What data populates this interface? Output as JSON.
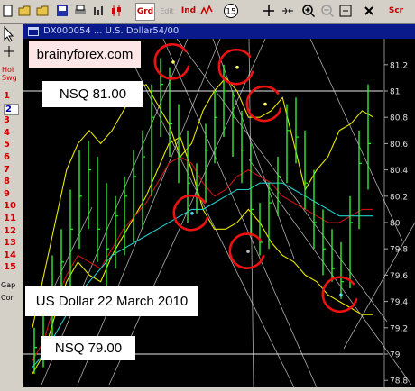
{
  "toolbar": {
    "fn_label": "Grd",
    "edit_label": "Edit",
    "ind_label": "Ind",
    "circle_label": "15",
    "scr_label": "Scr"
  },
  "left_panel": {
    "hot": "Hot",
    "swg": "Swg",
    "numbers": [
      "1",
      "2",
      "3",
      "4",
      "5",
      "6",
      "7",
      "8",
      "9",
      "10",
      "11",
      "12",
      "13",
      "14",
      "15"
    ],
    "gap": "Gap",
    "con": "Con"
  },
  "window": {
    "title": "DX000054 ... U.S. Dollar54/00"
  },
  "overlays": {
    "site": "brainyforex.com",
    "nsq_top": "NSQ 81.00",
    "caption": "US Dollar 22 March 2010",
    "nsq_bottom": "NSQ 79.00"
  },
  "colors": {
    "background": "#000000",
    "bars": "#33ee33",
    "yellow_band": "#e8e800",
    "red_ma": "#cc1111",
    "cyan_ma": "#22cccc",
    "white_lines": "#e8e8e8",
    "circles": "#ee1111",
    "title_bar": "#0a1a8a"
  },
  "chart_data": {
    "type": "bar",
    "title": "",
    "xlabel": "",
    "ylabel": "",
    "ylim": [
      78.8,
      81.3
    ],
    "y_ticks": [
      "81.2",
      "81",
      "80.8",
      "80.6",
      "80.4",
      "80.2",
      "80",
      "79.8",
      "79.6",
      "79.4",
      "79.2",
      "79",
      "78.8"
    ],
    "y_tick_values": [
      81.2,
      81.0,
      80.8,
      80.6,
      80.4,
      80.2,
      80.0,
      79.8,
      79.6,
      79.4,
      79.2,
      79.0,
      78.8
    ],
    "horizontal_levels": [
      81.0,
      79.0
    ],
    "bars": [
      {
        "h": 79.2,
        "l": 78.85,
        "c": 79.05
      },
      {
        "h": 79.45,
        "l": 78.9,
        "c": 79.3
      },
      {
        "h": 79.75,
        "l": 79.05,
        "c": 79.5
      },
      {
        "h": 79.95,
        "l": 79.3,
        "c": 79.7
      },
      {
        "h": 80.25,
        "l": 79.5,
        "c": 79.95
      },
      {
        "h": 80.55,
        "l": 79.8,
        "c": 80.2
      },
      {
        "h": 80.62,
        "l": 79.95,
        "c": 80.4
      },
      {
        "h": 80.5,
        "l": 79.7,
        "c": 79.95
      },
      {
        "h": 80.3,
        "l": 79.5,
        "c": 79.8
      },
      {
        "h": 80.2,
        "l": 79.65,
        "c": 80.05
      },
      {
        "h": 80.35,
        "l": 79.75,
        "c": 80.2
      },
      {
        "h": 80.55,
        "l": 79.85,
        "c": 80.35
      },
      {
        "h": 80.7,
        "l": 79.95,
        "c": 80.5
      },
      {
        "h": 81.05,
        "l": 80.2,
        "c": 80.8
      },
      {
        "h": 81.25,
        "l": 80.65,
        "c": 81.05
      },
      {
        "h": 81.18,
        "l": 80.5,
        "c": 80.75
      },
      {
        "h": 80.9,
        "l": 80.3,
        "c": 80.5
      },
      {
        "h": 80.7,
        "l": 80.0,
        "c": 80.3
      },
      {
        "h": 80.45,
        "l": 80.07,
        "c": 80.2
      },
      {
        "h": 80.75,
        "l": 80.15,
        "c": 80.55
      },
      {
        "h": 81.0,
        "l": 80.45,
        "c": 80.8
      },
      {
        "h": 81.2,
        "l": 80.65,
        "c": 81.0
      },
      {
        "h": 81.0,
        "l": 80.5,
        "c": 80.8
      },
      {
        "h": 80.85,
        "l": 80.3,
        "c": 80.55
      },
      {
        "h": 80.6,
        "l": 79.9,
        "c": 80.1
      },
      {
        "h": 80.15,
        "l": 79.75,
        "c": 79.85
      },
      {
        "h": 80.3,
        "l": 79.8,
        "c": 80.15
      },
      {
        "h": 80.5,
        "l": 80.05,
        "c": 80.35
      },
      {
        "h": 80.9,
        "l": 80.3,
        "c": 80.7
      },
      {
        "h": 80.95,
        "l": 80.45,
        "c": 80.65
      },
      {
        "h": 80.7,
        "l": 80.1,
        "c": 80.3
      },
      {
        "h": 80.4,
        "l": 79.8,
        "c": 80.0
      },
      {
        "h": 80.1,
        "l": 79.6,
        "c": 79.8
      },
      {
        "h": 79.95,
        "l": 79.55,
        "c": 79.65
      },
      {
        "h": 79.85,
        "l": 79.42,
        "c": 79.55
      },
      {
        "h": 80.2,
        "l": 79.5,
        "c": 80.0
      },
      {
        "h": 80.7,
        "l": 79.95,
        "c": 80.45
      },
      {
        "h": 81.05,
        "l": 80.25,
        "c": 80.6
      }
    ],
    "series": [
      {
        "name": "",
        "color": "#e8e800",
        "values": [
          79.2,
          79.6,
          80.0,
          80.4,
          80.6,
          80.7,
          80.6,
          80.7,
          80.85,
          81.0,
          81.05,
          80.9,
          80.75,
          80.5,
          80.6,
          80.85,
          81.0,
          81.1,
          81.0,
          80.8,
          80.8,
          80.85,
          80.95,
          80.6,
          80.25,
          80.4,
          80.5,
          80.7,
          80.75,
          80.85,
          80.8
        ]
      },
      {
        "name": "",
        "color": "#e8e800",
        "values": [
          78.85,
          79.0,
          79.3,
          79.55,
          79.7,
          79.6,
          79.55,
          79.75,
          79.9,
          80.05,
          80.2,
          80.4,
          80.6,
          80.65,
          80.4,
          80.1,
          79.95,
          79.95,
          80.0,
          80.1,
          80.0,
          79.85,
          79.75,
          79.7,
          79.6,
          79.55,
          79.45,
          79.4,
          79.35,
          79.3,
          79.3
        ]
      },
      {
        "name": "",
        "color": "#cc1111",
        "values": [
          78.95,
          79.1,
          79.4,
          79.6,
          79.75,
          79.7,
          79.65,
          79.8,
          79.95,
          80.05,
          80.15,
          80.3,
          80.45,
          80.5,
          80.45,
          80.3,
          80.2,
          80.25,
          80.35,
          80.4,
          80.35,
          80.3,
          80.2,
          80.15,
          80.1,
          80.05,
          80.0,
          80.0,
          80.05,
          80.1,
          80.1
        ]
      },
      {
        "name": "",
        "color": "#22cccc",
        "values": [
          78.9,
          79.0,
          79.15,
          79.3,
          79.45,
          79.55,
          79.65,
          79.75,
          79.8,
          79.85,
          79.9,
          79.95,
          80.0,
          80.05,
          80.1,
          80.1,
          80.15,
          80.2,
          80.25,
          80.25,
          80.3,
          80.3,
          80.3,
          80.25,
          80.2,
          80.15,
          80.1,
          80.05,
          80.05,
          80.05,
          80.05
        ]
      }
    ],
    "highlighted_points": [
      81.22,
      81.18,
      80.9,
      80.07,
      79.78,
      79.45
    ]
  }
}
